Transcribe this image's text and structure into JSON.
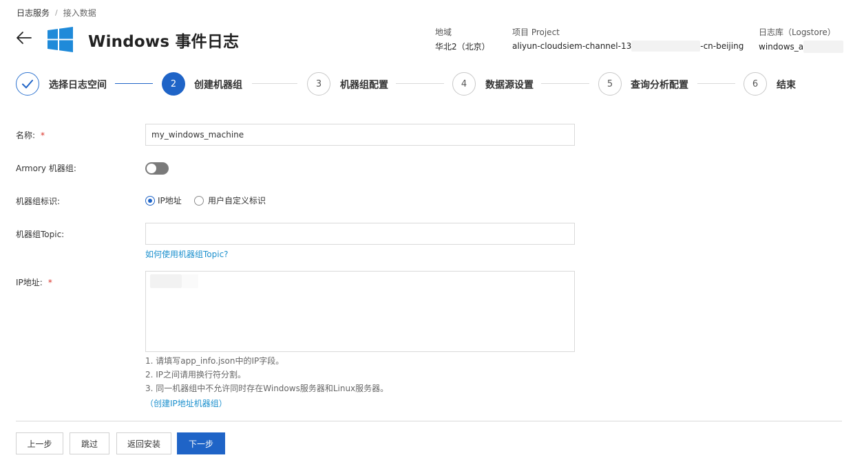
{
  "breadcrumb": {
    "root": "日志服务",
    "separator": "/",
    "current": "接入数据"
  },
  "header": {
    "title": "Windows 事件日志",
    "region_label": "地域",
    "region_value": "华北2（北京）",
    "project_label": "项目 Project",
    "project_value_prefix": "aliyun-cloudsiem-channel-13",
    "project_value_suffix": "-cn-beijing",
    "logstore_label": "日志库（Logstore）",
    "logstore_value": "windows_a"
  },
  "steps": [
    {
      "number": "",
      "label": "选择日志空间",
      "state": "done"
    },
    {
      "number": "2",
      "label": "创建机器组",
      "state": "active"
    },
    {
      "number": "3",
      "label": "机器组配置",
      "state": "todo"
    },
    {
      "number": "4",
      "label": "数据源设置",
      "state": "todo"
    },
    {
      "number": "5",
      "label": "查询分析配置",
      "state": "todo"
    },
    {
      "number": "6",
      "label": "结束",
      "state": "todo"
    }
  ],
  "form": {
    "name_label": "名称:",
    "required_mark": "*",
    "name_value": "my_windows_machine",
    "armory_label": "Armory 机器组:",
    "armory_enabled": false,
    "identity_label": "机器组标识:",
    "identity_options": [
      "IP地址",
      "用户自定义标识"
    ],
    "identity_selected": "IP地址",
    "topic_label": "机器组Topic:",
    "topic_value": "",
    "topic_help_link": "如何使用机器组Topic?",
    "ip_label": "IP地址:",
    "ip_hints": [
      "1. 请填写app_info.json中的IP字段。",
      "2. IP之间请用换行符分割。",
      "3. 同一机器组中不允许同时存在Windows服务器和Linux服务器。"
    ],
    "ip_create_link": "（创建IP地址机器组）"
  },
  "footer": {
    "prev_label": "上一步",
    "skip_label": "跳过",
    "back_install_label": "返回安装",
    "next_label": "下一步"
  },
  "colors": {
    "primary": "#1f64c7",
    "link": "#1a8fcd",
    "required": "#d93026"
  }
}
